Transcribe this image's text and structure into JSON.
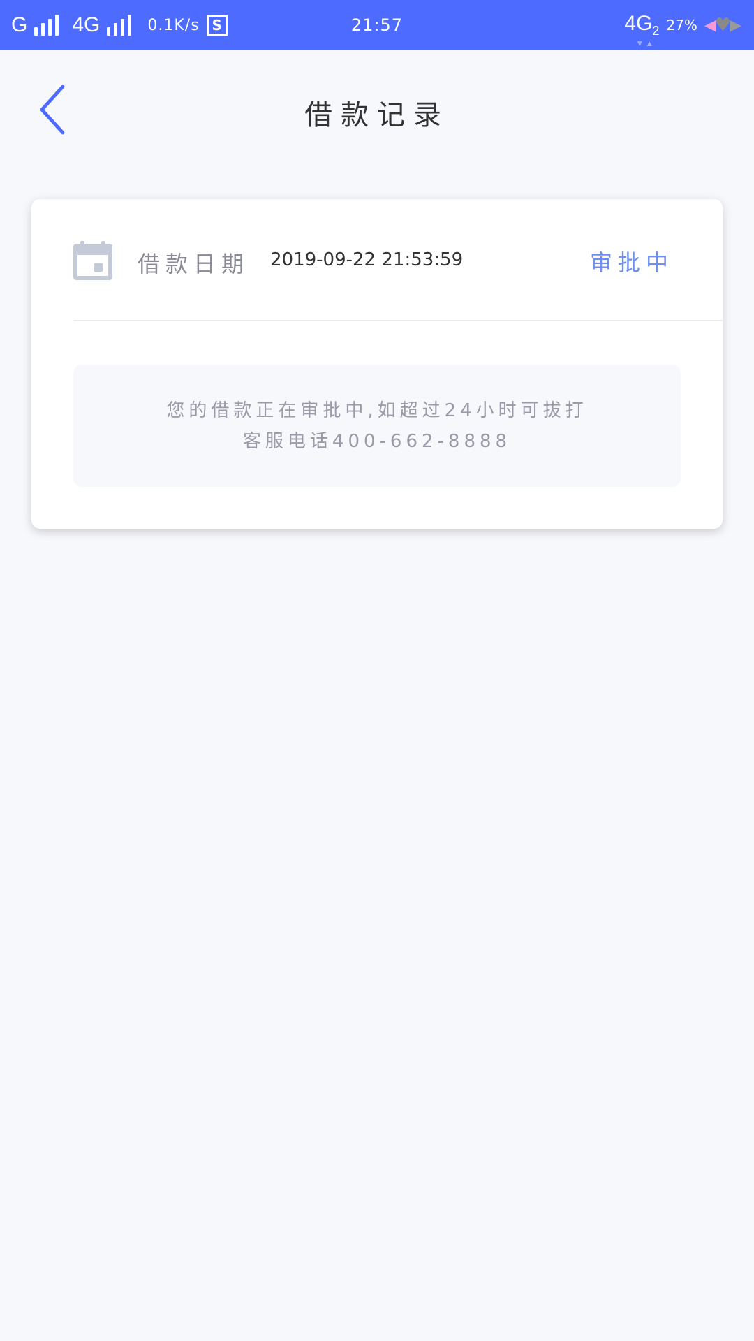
{
  "status_bar": {
    "network_1": "G",
    "network_2": "4G",
    "speed": "0.1K/s",
    "s_icon": "S",
    "time": "21:57",
    "network_right": "4G",
    "network_right_sub": "2",
    "battery_percent": "27%",
    "background_color": "#4d6bfe"
  },
  "header": {
    "back_icon": "chevron-left-icon",
    "title": "借款记录"
  },
  "record": {
    "date_label": "借款日期",
    "date_value": "2019-09-22 21:53:59",
    "status": "审批中",
    "status_color": "#6f8ff0",
    "notice_line_1": "您的借款正在审批中,如超过24小时可拔打",
    "notice_line_2": "客服电话400-662-8888"
  }
}
